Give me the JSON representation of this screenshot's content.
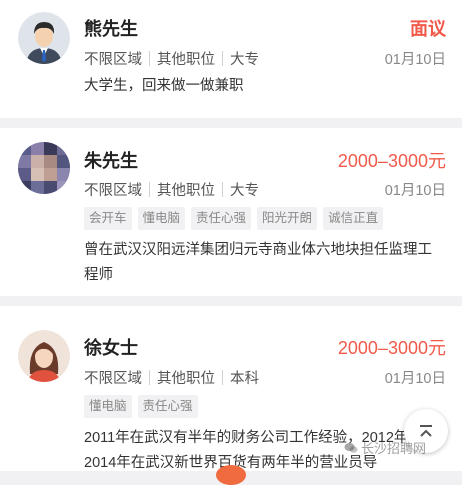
{
  "listings": [
    {
      "name": "熊先生",
      "salary": "面议",
      "meta": [
        "不限区域",
        "其他职位",
        "大专"
      ],
      "date": "01月10日",
      "tags": [],
      "description": "大学生，回来做一做兼职"
    },
    {
      "name": "朱先生",
      "salary": "2000–3000元",
      "meta": [
        "不限区域",
        "其他职位",
        "大专"
      ],
      "date": "01月10日",
      "tags": [
        "会开车",
        "懂电脑",
        "责任心强",
        "阳光开朗",
        "诚信正直"
      ],
      "description": "曾在武汉汉阳远洋集团归元寺商业体六地块担任监理工程师"
    },
    {
      "name": "徐女士",
      "salary": "2000–3000元",
      "meta": [
        "不限区域",
        "其他职位",
        "本科"
      ],
      "date": "01月10日",
      "tags": [
        "懂电脑",
        "责任心强"
      ],
      "description": "2011年在武汉有半年的财务公司工作经验，2012年–2014年在武汉新世界百货有两年半的营业员导"
    }
  ],
  "watermark": "长沙招聘网",
  "colors": {
    "accent": "#f15a4a",
    "tag_bg": "#f1f1f3",
    "separator": "#f1f1f4"
  },
  "icons": {
    "fab": "arrow-up-icon",
    "watermark": "wechat-icon"
  }
}
